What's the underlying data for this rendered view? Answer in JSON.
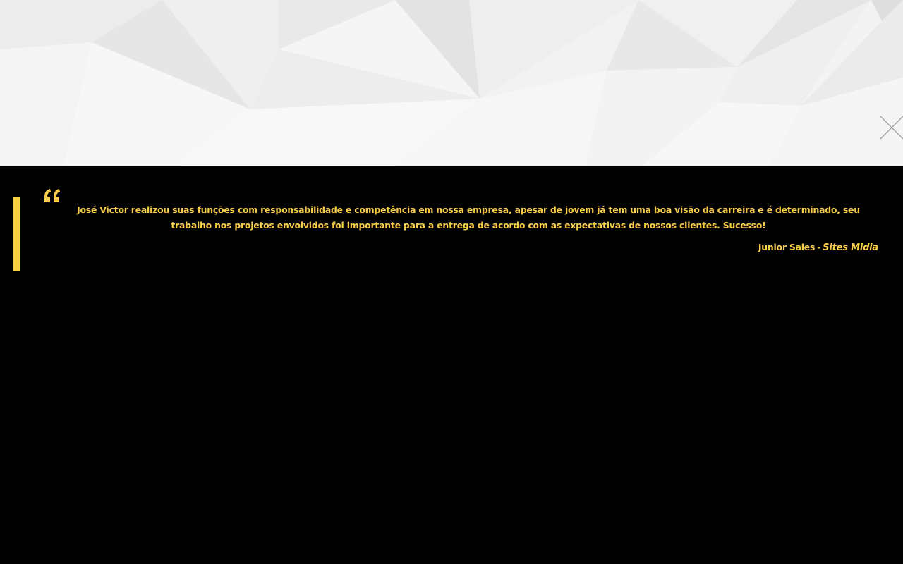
{
  "hero": {
    "close_icon": "close-x-icon"
  },
  "testimonial": {
    "quote_icon": "quote-open-icon",
    "text": "José Victor realizou suas funções com responsabilidade e competência em nossa empresa, apesar de jovem já tem uma boa visão da carreira e é determinado, seu trabalho nos projetos envolvidos foi importante para a entrega de acordo com as expectativas de nossos clientes. Sucesso!",
    "author_name": "Junior Sales",
    "separator": "-",
    "company": "Sites Midia"
  },
  "colors": {
    "accent": "#f9cf4a",
    "background": "#000000",
    "hero_background": "#f3f3f3"
  }
}
